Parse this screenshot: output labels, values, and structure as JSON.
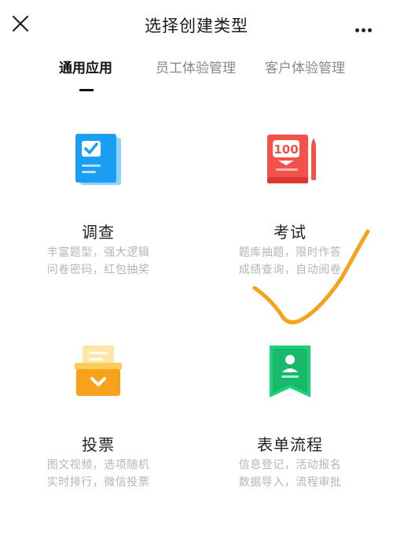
{
  "header": {
    "title": "选择创建类型",
    "close_icon": "close-icon",
    "more_icon": "more-dots-icon"
  },
  "tabs": [
    {
      "label": "通用应用",
      "active": true
    },
    {
      "label": "员工体验管理",
      "active": false
    },
    {
      "label": "客户体验管理",
      "active": false
    }
  ],
  "cards": [
    {
      "name": "调查",
      "desc_line1": "丰富题型，强大逻辑",
      "desc_line2": "问卷密码，红包抽奖",
      "icon": "survey-icon",
      "color": "#1a9ff5"
    },
    {
      "name": "考试",
      "desc_line1": "题库抽题，限时作答",
      "desc_line2": "成绩查询，自动阅卷",
      "icon": "exam-icon",
      "badge": "100",
      "color": "#f2524a"
    },
    {
      "name": "投票",
      "desc_line1": "图文视频，选项随机",
      "desc_line2": "实时排行，微信投票",
      "icon": "vote-icon",
      "color": "#f7a21b"
    },
    {
      "name": "表单流程",
      "desc_line1": "信息登记，活动报名",
      "desc_line2": "数据导入，流程审批",
      "icon": "form-flow-icon",
      "color": "#1ed07a"
    }
  ],
  "annotation_color": "#f5a21c"
}
